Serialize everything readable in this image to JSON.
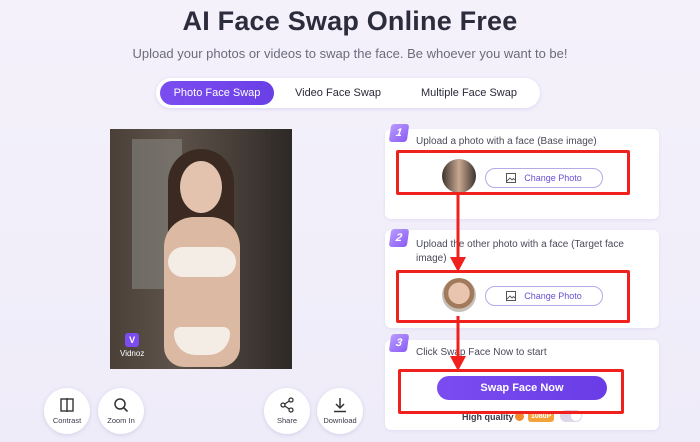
{
  "header": {
    "title": "AI Face Swap Online Free",
    "subtitle": "Upload your photos or videos to swap the face. Be whoever you want to be!"
  },
  "tabs": [
    {
      "label": "Photo Face Swap",
      "active": true
    },
    {
      "label": "Video Face Swap",
      "active": false
    },
    {
      "label": "Multiple Face Swap",
      "active": false
    }
  ],
  "preview": {
    "watermark": "Vidnoz",
    "watermark_icon": "vidnoz-logo-icon"
  },
  "tools": [
    {
      "label": "Contrast",
      "icon": "contrast-icon"
    },
    {
      "label": "Zoom In",
      "icon": "zoom-in-icon"
    },
    {
      "label": "Share",
      "icon": "share-icon"
    },
    {
      "label": "Download",
      "icon": "download-icon"
    }
  ],
  "steps": [
    {
      "number": "1",
      "text": "Upload a photo with a face (Base image)",
      "button": "Change Photo"
    },
    {
      "number": "2",
      "text": "Upload the other photo with a face (Target face image)",
      "button": "Change Photo"
    },
    {
      "number": "3",
      "text": "Click Swap Face Now to start",
      "button": "Swap Face Now"
    }
  ],
  "options": {
    "high_quality_label": "High quality",
    "badge": "1080P",
    "high_quality_enabled": false
  },
  "colors": {
    "accent": "#6a3ce6",
    "highlight": "#f0201c",
    "background": "#f2effa"
  }
}
